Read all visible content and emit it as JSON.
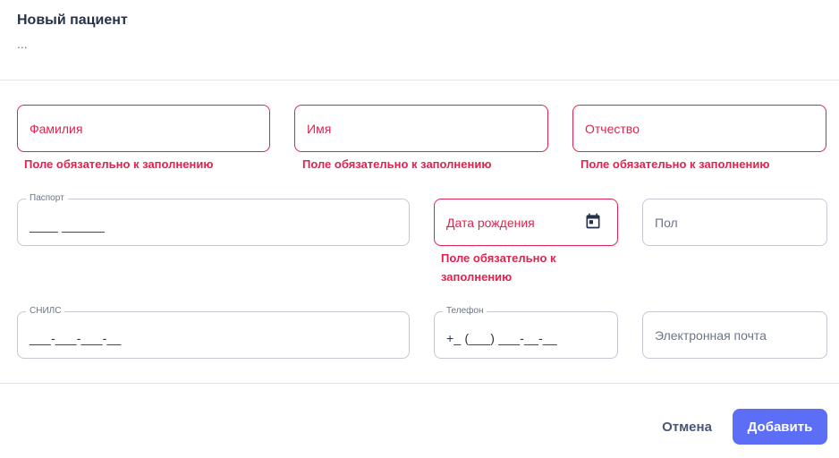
{
  "header": {
    "title": "Новый пациент",
    "subtitle": "..."
  },
  "fields": {
    "lastname": {
      "placeholder": "Фамилия",
      "error": "Поле обязательно к заполнению"
    },
    "firstname": {
      "placeholder": "Имя",
      "error": "Поле обязательно к заполнению"
    },
    "patronymic": {
      "placeholder": "Отчество",
      "error": "Поле обязательно к заполнению"
    },
    "passport": {
      "label": "Паспорт",
      "value": "____ ______"
    },
    "birthdate": {
      "placeholder": "Дата рождения",
      "error_line1": "Поле обязательно к",
      "error_line2": "заполнению",
      "icon": "calendar-icon"
    },
    "gender": {
      "placeholder": "Пол"
    },
    "snils": {
      "label": "СНИЛС",
      "value": "___-___-___-__"
    },
    "phone": {
      "label": "Телефон",
      "value": "+_ (___) ___-__-__"
    },
    "email": {
      "placeholder": "Электронная почта"
    }
  },
  "footer": {
    "cancel_label": "Отмена",
    "add_label": "Добавить"
  },
  "colors": {
    "error": "#e0234e",
    "accent": "#5b6ef5",
    "border": "#c4c8d0"
  }
}
